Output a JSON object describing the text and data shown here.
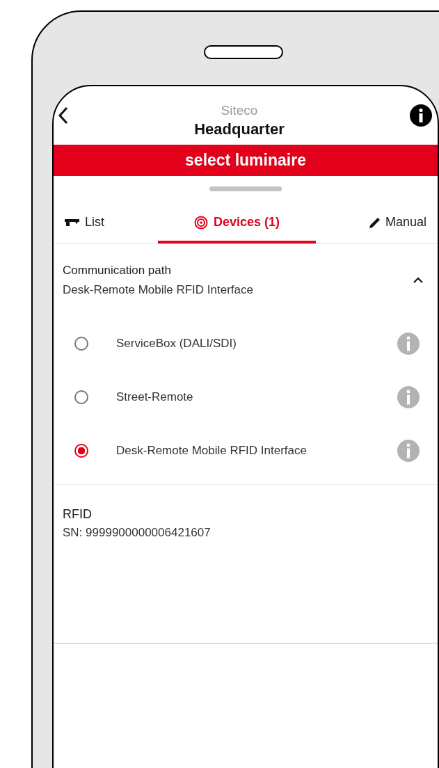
{
  "header": {
    "subtitle": "Siteco",
    "title": "Headquarter"
  },
  "banner": {
    "text": "select luminaire"
  },
  "tabs": [
    {
      "label": "List",
      "selected": false
    },
    {
      "label": "Devices (1)",
      "selected": true
    },
    {
      "label": "Manual",
      "selected": false
    }
  ],
  "communication_path": {
    "label": "Communication path",
    "value": "Desk-Remote Mobile RFID Interface",
    "expanded": true,
    "options": [
      {
        "label": "ServiceBox (DALI/SDI)",
        "selected": false
      },
      {
        "label": "Street-Remote",
        "selected": false
      },
      {
        "label": "Desk-Remote Mobile RFID Interface",
        "selected": true
      }
    ]
  },
  "device": {
    "type": "RFID",
    "serial": "SN: 9999900000006421607"
  }
}
